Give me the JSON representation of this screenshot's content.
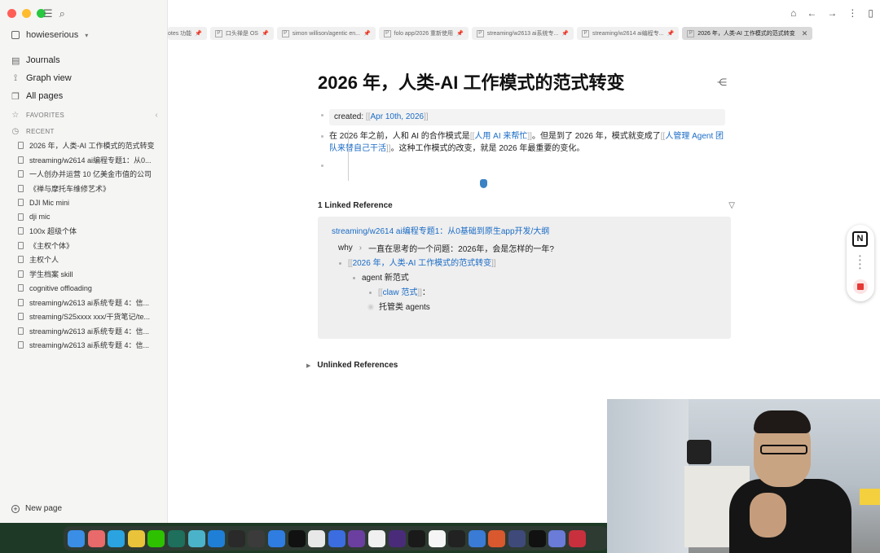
{
  "workspace": {
    "name": "howieserious"
  },
  "sidebar": {
    "nav": [
      {
        "label": "Journals",
        "icon": "calendar-icon"
      },
      {
        "label": "Graph view",
        "icon": "graph-icon"
      },
      {
        "label": "All pages",
        "icon": "pages-icon"
      }
    ],
    "favorites_label": "FAVORITES",
    "recent_label": "RECENT",
    "recent": [
      "2026 年，人类-AI 工作模式的范式转变",
      "streaming/w2614 ai编程专题1：从0...",
      "一人创办并运营 10 亿美金市值的公司",
      "《禅与摩托车维修艺术》",
      "DJI Mic mini",
      "dji mic",
      "100x 超级个体",
      "《主权个体》",
      "主权个人",
      "学生档案 skill",
      "cognitive offloading",
      "streaming/w2613 ai系统专题 4：信...",
      "streaming/S25xxxx xxx/干货笔记/te...",
      "streaming/w2613 ai系统专题 4：信...",
      "streaming/w2613 ai系统专题 4：信..."
    ],
    "new_page": "New page"
  },
  "tabs": [
    {
      "label": "otes 功能",
      "pinned": true,
      "active": false,
      "partial": true
    },
    {
      "label": "口头禅是 OS",
      "pinned": true,
      "active": false
    },
    {
      "label": "simon willison/agentic en...",
      "pinned": true,
      "active": false
    },
    {
      "label": "folo app/2026 重新使用",
      "pinned": true,
      "active": false
    },
    {
      "label": "streaming/w2613 ai系统专...",
      "pinned": true,
      "active": false
    },
    {
      "label": "streaming/w2614 ai编程专...",
      "pinned": true,
      "active": false
    },
    {
      "label": "2026 年，人类-AI 工作模式的范式转变",
      "pinned": false,
      "active": true
    }
  ],
  "page": {
    "title": "2026 年，人类-AI 工作模式的范式转变",
    "property_key": "created:",
    "property_value": "Apr 10th, 2026",
    "para_1": "在 2026 年之前，人和 AI 的合作模式是",
    "link_1": "人用 AI 来帮忙",
    "para_2": "。但是到了 2026 年，模式就变成了",
    "link_2": "人管理 Agent 团队来替自己干活",
    "para_3": "。这种工作模式的改变，就是 2026 年最重要的变化。"
  },
  "linked": {
    "header": "1 Linked Reference",
    "ref_page": "streaming/w2614 ai编程专题1：从0基础到原生app开发/大纲",
    "crumb_1": "why",
    "crumb_2": "一直在思考的一个问题：2026年，会是怎样的一年?",
    "ref_link": "2026 年，人类-AI 工作模式的范式转变",
    "child_1": "agent 新范式",
    "child_2_link": "claw 范式",
    "child_2_suffix": "：",
    "child_3": "托管类 agents"
  },
  "unlinked": {
    "header": "Unlinked References"
  },
  "widget": {
    "logo": "N"
  },
  "dock": [
    {
      "name": "finder",
      "color": "#3a8ee6"
    },
    {
      "name": "photos",
      "color": "#e86a6a"
    },
    {
      "name": "telegram",
      "color": "#2aa3e0"
    },
    {
      "name": "chrome",
      "color": "#e9c33a"
    },
    {
      "name": "wechat",
      "color": "#2dc100"
    },
    {
      "name": "app-6",
      "color": "#1e6f5c"
    },
    {
      "name": "app-7",
      "color": "#4bb3c9"
    },
    {
      "name": "vscode",
      "color": "#1f7fd6"
    },
    {
      "name": "app-9",
      "color": "#2a2a2a"
    },
    {
      "name": "r-app",
      "color": "#3b3b3b"
    },
    {
      "name": "app-11",
      "color": "#2f7de1"
    },
    {
      "name": "figma",
      "color": "#111111"
    },
    {
      "name": "app-13",
      "color": "#e8e8e8"
    },
    {
      "name": "app-14",
      "color": "#3b6de0"
    },
    {
      "name": "obsidian",
      "color": "#6b3fa0"
    },
    {
      "name": "notion",
      "color": "#f0f0f0"
    },
    {
      "name": "app-17",
      "color": "#4a2b7a"
    },
    {
      "name": "chatgpt",
      "color": "#1a1a1a"
    },
    {
      "name": "panda",
      "color": "#f5f5f5"
    },
    {
      "name": "app-20",
      "color": "#222222"
    },
    {
      "name": "app-21",
      "color": "#3a7bd5"
    },
    {
      "name": "app-22",
      "color": "#d9582e"
    },
    {
      "name": "app-23",
      "color": "#3f4a7a"
    },
    {
      "name": "app-24",
      "color": "#111111"
    },
    {
      "name": "app-25",
      "color": "#6a7bd8"
    },
    {
      "name": "app-26",
      "color": "#c9303e"
    }
  ]
}
